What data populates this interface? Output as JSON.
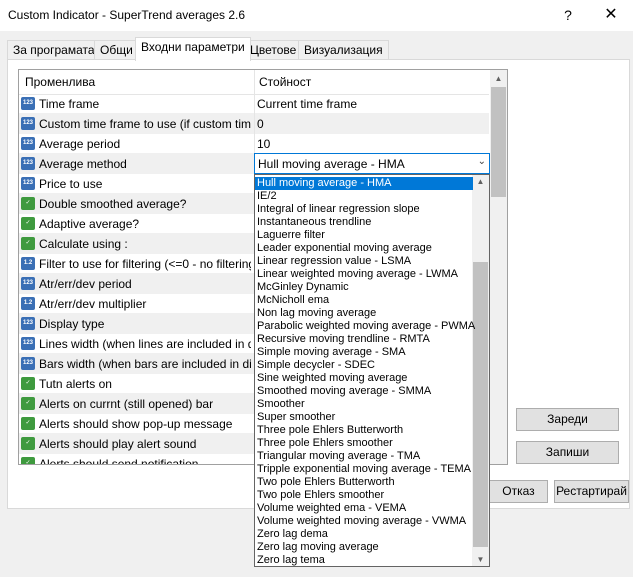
{
  "window": {
    "title": "Custom Indicator - SuperTrend averages 2.6",
    "help_label": "?",
    "close_label": "✕"
  },
  "tabs": [
    {
      "label": "За програмата"
    },
    {
      "label": "Общи"
    },
    {
      "label": "Входни параметри"
    },
    {
      "label": "Цветове"
    },
    {
      "label": "Визуализация"
    }
  ],
  "grid": {
    "col_name": "Променлива",
    "col_value": "Стойност",
    "rows": [
      {
        "name": "Time frame",
        "value": "Current time frame",
        "icon": "list-icon"
      },
      {
        "name": "Custom time frame to use (if custom time fr...",
        "value": "0",
        "icon": "number-icon"
      },
      {
        "name": "Average period",
        "value": "10",
        "icon": "number-icon"
      },
      {
        "name": "Average method",
        "value": "",
        "icon": "number-icon"
      },
      {
        "name": "Price to use",
        "value": "",
        "icon": "number-icon"
      },
      {
        "name": "Double smoothed average?",
        "value": "",
        "icon": "bool-icon"
      },
      {
        "name": "Adaptive average?",
        "value": "",
        "icon": "bool-icon"
      },
      {
        "name": "Calculate using :",
        "value": "",
        "icon": "bool-icon"
      },
      {
        "name": "Filter to use for filtering (<=0 - no filtering)",
        "value": "",
        "icon": "double-icon"
      },
      {
        "name": "Atr/err/dev period",
        "value": "",
        "icon": "number-icon"
      },
      {
        "name": "Atr/err/dev multiplier",
        "value": "",
        "icon": "double-icon"
      },
      {
        "name": "Display type",
        "value": "",
        "icon": "number-icon"
      },
      {
        "name": "Lines width (when lines are included in dis...",
        "value": "",
        "icon": "number-icon"
      },
      {
        "name": "Bars width (when bars are included in displ...",
        "value": "",
        "icon": "number-icon"
      },
      {
        "name": "Tutn alerts on",
        "value": "",
        "icon": "bool-icon"
      },
      {
        "name": "Alerts on currnt (still opened) bar",
        "value": "",
        "icon": "bool-icon"
      },
      {
        "name": "Alerts should show pop-up message",
        "value": "",
        "icon": "bool-icon"
      },
      {
        "name": "Alerts should play alert sound",
        "value": "",
        "icon": "bool-icon"
      },
      {
        "name": "Alerts should send notification",
        "value": "",
        "icon": "bool-icon"
      }
    ]
  },
  "combo": {
    "value": "Hull moving average - HMA",
    "arrow": "⌄"
  },
  "dropdown": {
    "selected_index": 0,
    "options": [
      "Hull moving average - HMA",
      "IE/2",
      "Integral of linear regression slope",
      "Instantaneous trendline",
      "Laguerre filter",
      "Leader exponential moving average",
      "Linear regression value - LSMA",
      "Linear weighted moving average - LWMA",
      "McGinley Dynamic",
      "McNicholl ema",
      "Non lag moving average",
      "Parabolic weighted moving average - PWMA",
      "Recursive moving trendline - RMTA",
      "Simple moving average - SMA",
      "Simple decycler - SDEC",
      "Sine weighted moving average",
      "Smoothed moving average - SMMA",
      "Smoother",
      "Super smoother",
      "Three pole Ehlers Butterworth",
      "Three pole Ehlers smoother",
      "Triangular moving average - TMA",
      "Tripple exponential moving average - TEMA",
      "Two pole Ehlers Butterworth",
      "Two pole Ehlers smoother",
      "Volume weighted ema - VEMA",
      "Volume weighted moving average - VWMA",
      "Zero lag dema",
      "Zero lag moving average",
      "Zero lag tema"
    ]
  },
  "buttons": {
    "load": "Зареди",
    "save": "Запиши",
    "cancel": "Отказ",
    "reset": "Рестартирай"
  },
  "icons": {
    "scroll_up": "▲",
    "scroll_down": "▼"
  },
  "colors": {
    "selection": "#0078d7",
    "bool_icon": "#3e9a3e",
    "number_icon": "#3a6fb5"
  }
}
